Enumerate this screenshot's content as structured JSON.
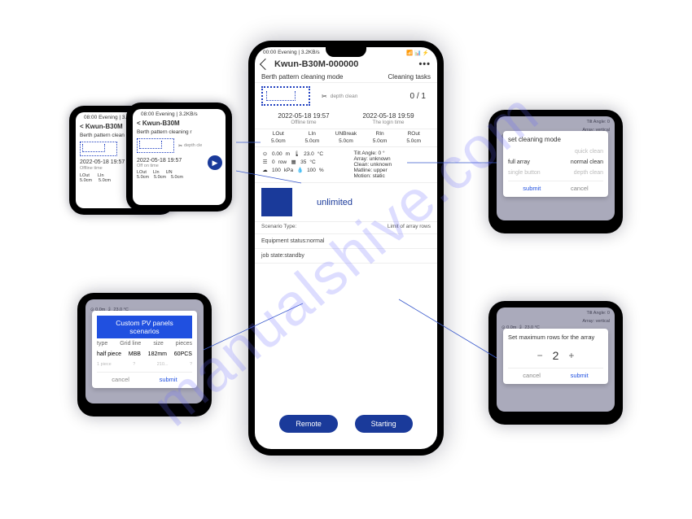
{
  "watermark": "manualshive.com",
  "center_phone": {
    "status": {
      "time": "00:00 Evening | 3.2KB/s",
      "signal": "📶 📊 ⚡"
    },
    "title": "Kwun-B30M-000000",
    "mode_label": "Berth pattern cleaning mode",
    "tasks_label": "Cleaning tasks",
    "depth_clean_label": "depth clean",
    "tasks_count": "0 / 1",
    "offline_time": "2022-05-18 19:57",
    "offline_label": "Offline time",
    "login_time": "2022-05-18 19:59",
    "login_label": "The login time",
    "measures": {
      "headers": [
        "LOut",
        "LIn",
        "UNBreak",
        "RIn",
        "ROut"
      ],
      "values": [
        "5.0cm",
        "5.0cm",
        "5.0cm",
        "5.0cm",
        "5.0cm"
      ]
    },
    "sensors_left": [
      {
        "icon": "⊙",
        "val": "0.00",
        "unit": "m",
        "icon2": "🌡",
        "val2": "23.0",
        "unit2": "°C"
      },
      {
        "icon": "☰",
        "val": "0",
        "unit": "row",
        "icon2": "▦",
        "val2": "35",
        "unit2": "°C"
      },
      {
        "icon": "☁",
        "val": "100",
        "unit": "kPa",
        "icon2": "💧",
        "val2": "100",
        "unit2": "%"
      }
    ],
    "sensors_right": [
      "Tilt Angle: 0 °",
      "Array: unknown",
      "Clean: unknown",
      "Matline: upper",
      "Motion: static"
    ],
    "scenario_value": "unlimited",
    "scenario_type_label": "Scenario Type:",
    "limit_label": "Limit of array rows",
    "equipment_status": "Equipment status:normal",
    "job_state": "job state:standby",
    "buttons": {
      "remote": "Remote",
      "starting": "Starting"
    }
  },
  "thumb_a": {
    "status": "08:00 Evening | 3.2KB/s",
    "title": "Kwun-B30M",
    "mode": "Berth pattern clean",
    "time": "2022-05-18 19:57",
    "time_label": "Offline time",
    "cols": [
      "LOut",
      "LIn"
    ],
    "vals": [
      "5.0cm",
      "5.0cm"
    ]
  },
  "thumb_b": {
    "status": "08:00 Evening | 3.2KB/s",
    "title": "Kwun-B30M",
    "mode": "Berth pattern cleaning r",
    "depth": "depth cle",
    "time": "2022-05-18 19:57",
    "time_label": "Off on time",
    "cols": [
      "LOut",
      "LIn",
      "UN"
    ],
    "vals": [
      "5.0cm",
      "5.0cm",
      "5.0cm"
    ]
  },
  "custom_panel_modal": {
    "title": "Custom PV panels scenarios",
    "headers": [
      "type",
      "Grid line",
      "size",
      "pieces"
    ],
    "row": [
      "half piece",
      "MBB",
      "182mm",
      "60PCS"
    ],
    "cancel": "cancel",
    "submit": "submit"
  },
  "cleaning_mode_modal": {
    "title": "set cleaning mode",
    "option_faded_top": "quick clean",
    "option_left": "full array",
    "option_right": "normal clean",
    "option_faded_bl": "single button",
    "option_faded_br": "depth clean",
    "submit": "submit",
    "cancel": "cancel"
  },
  "max_rows_modal": {
    "title": "Set maximum rows for the array",
    "value": "2",
    "cancel": "cancel",
    "submit": "submit"
  },
  "bg_text": {
    "line1": "Tilt Angle: 0",
    "line2": "Array: vertical",
    "sens": "⊙ 0.0m  🌡 23.0 °C"
  }
}
